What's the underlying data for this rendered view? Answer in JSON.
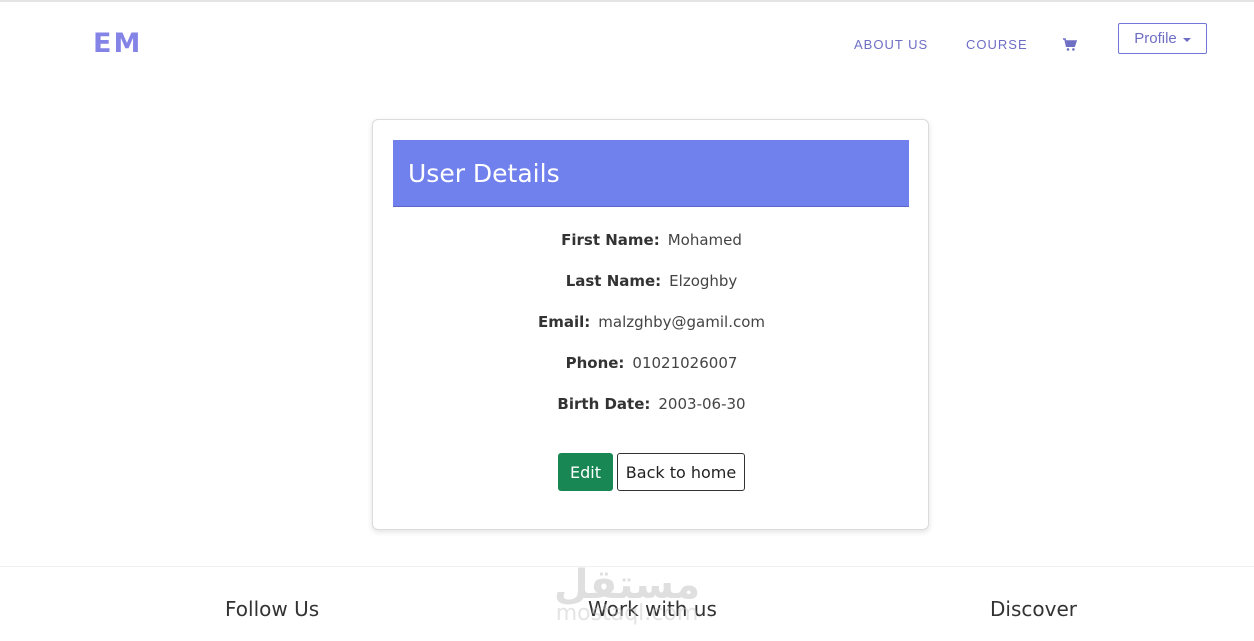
{
  "nav": {
    "brand": "EM",
    "links": [
      "ABOUT US",
      "COURSE"
    ],
    "cart_icon": "cart-icon",
    "profile_label": "Profile"
  },
  "card": {
    "title": "User Details",
    "rows": [
      {
        "label": "First Name:",
        "value": "Mohamed"
      },
      {
        "label": "Last Name:",
        "value": "Elzoghby"
      },
      {
        "label": "Email:",
        "value": "malzghby@gamil.com"
      },
      {
        "label": "Phone:",
        "value": "01021026007"
      },
      {
        "label": "Birth Date:",
        "value": "2003-06-30"
      }
    ],
    "edit_label": "Edit",
    "back_label": "Back to home"
  },
  "footer": {
    "columns": [
      "Follow Us",
      "Work with us",
      "Discover"
    ]
  },
  "watermark": {
    "arabic": "مستقل",
    "latin": "mostaql.com"
  },
  "colors": {
    "accent": "#7080ec",
    "brand": "#8483e6",
    "edit": "#198754"
  }
}
